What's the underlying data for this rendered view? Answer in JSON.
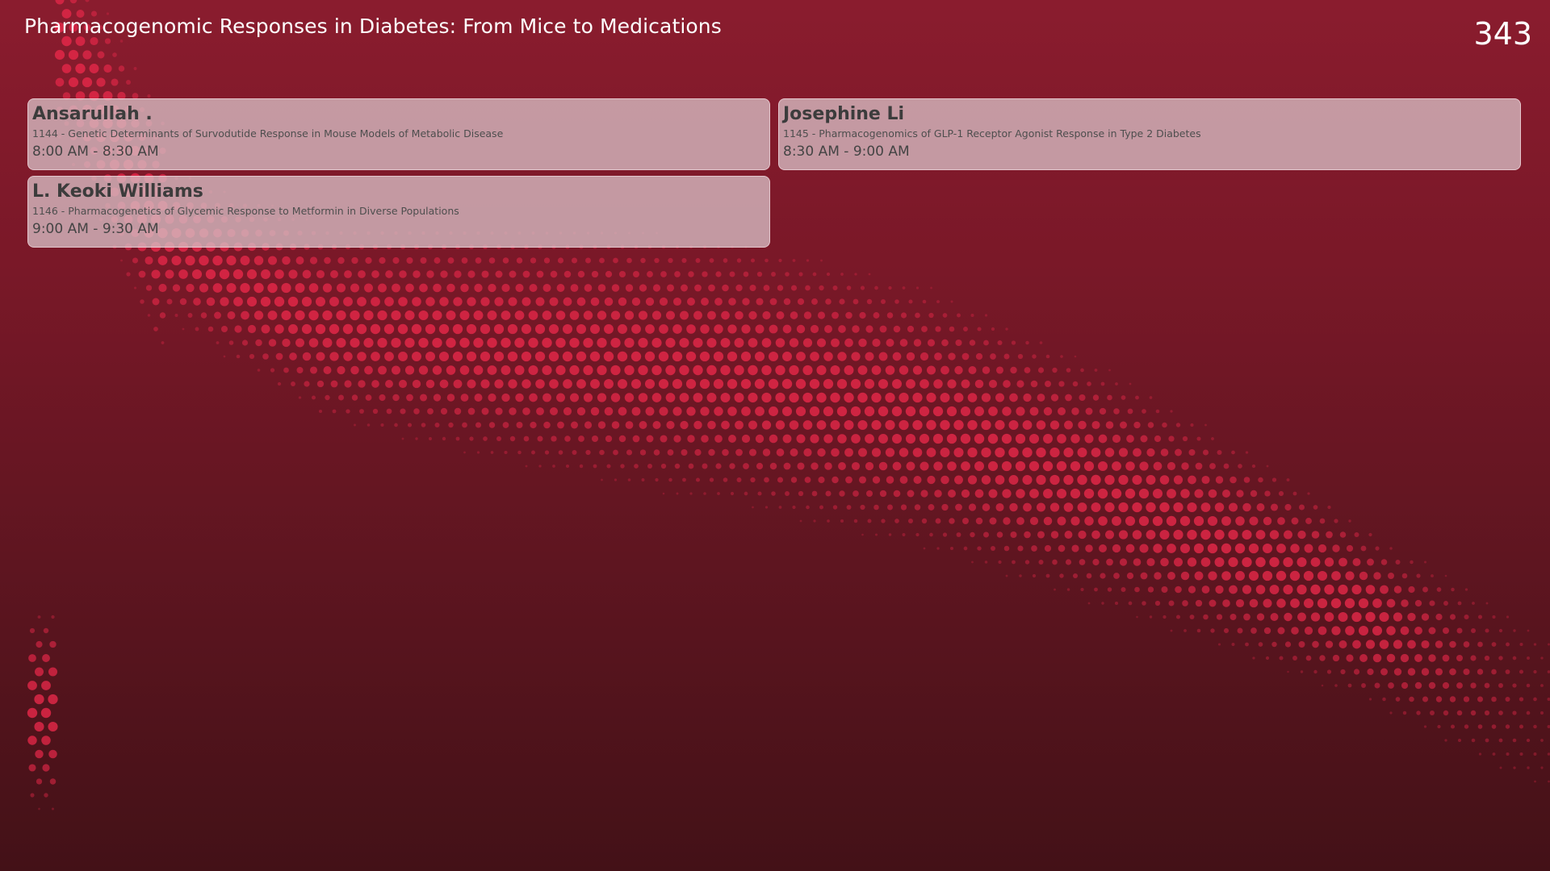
{
  "header": {
    "title": "Pharmacogenomic Responses in Diabetes: From Mice to Medications",
    "room_number": "343"
  },
  "sessions": [
    {
      "speaker": "Ansarullah .",
      "talk": "1144 - Genetic Determinants of Survodutide Response in Mouse Models of Metabolic Disease",
      "time": "8:00 AM - 8:30 AM"
    },
    {
      "speaker": "Josephine Li",
      "talk": "1145 - Pharmacogenomics of GLP-1 Receptor Agonist Response in Type 2 Diabetes",
      "time": "8:30 AM - 9:00 AM"
    },
    {
      "speaker": "L. Keoki Williams",
      "talk": "1146 - Pharmacogenetics of Glycemic Response to Metformin in Diverse Populations",
      "time": "9:00 AM - 9:30 AM"
    }
  ],
  "colors": {
    "background_top": "#8a1c2e",
    "background_bottom": "#431117",
    "dot_accent": "#e8284a",
    "card_background": "#d7bec4"
  }
}
